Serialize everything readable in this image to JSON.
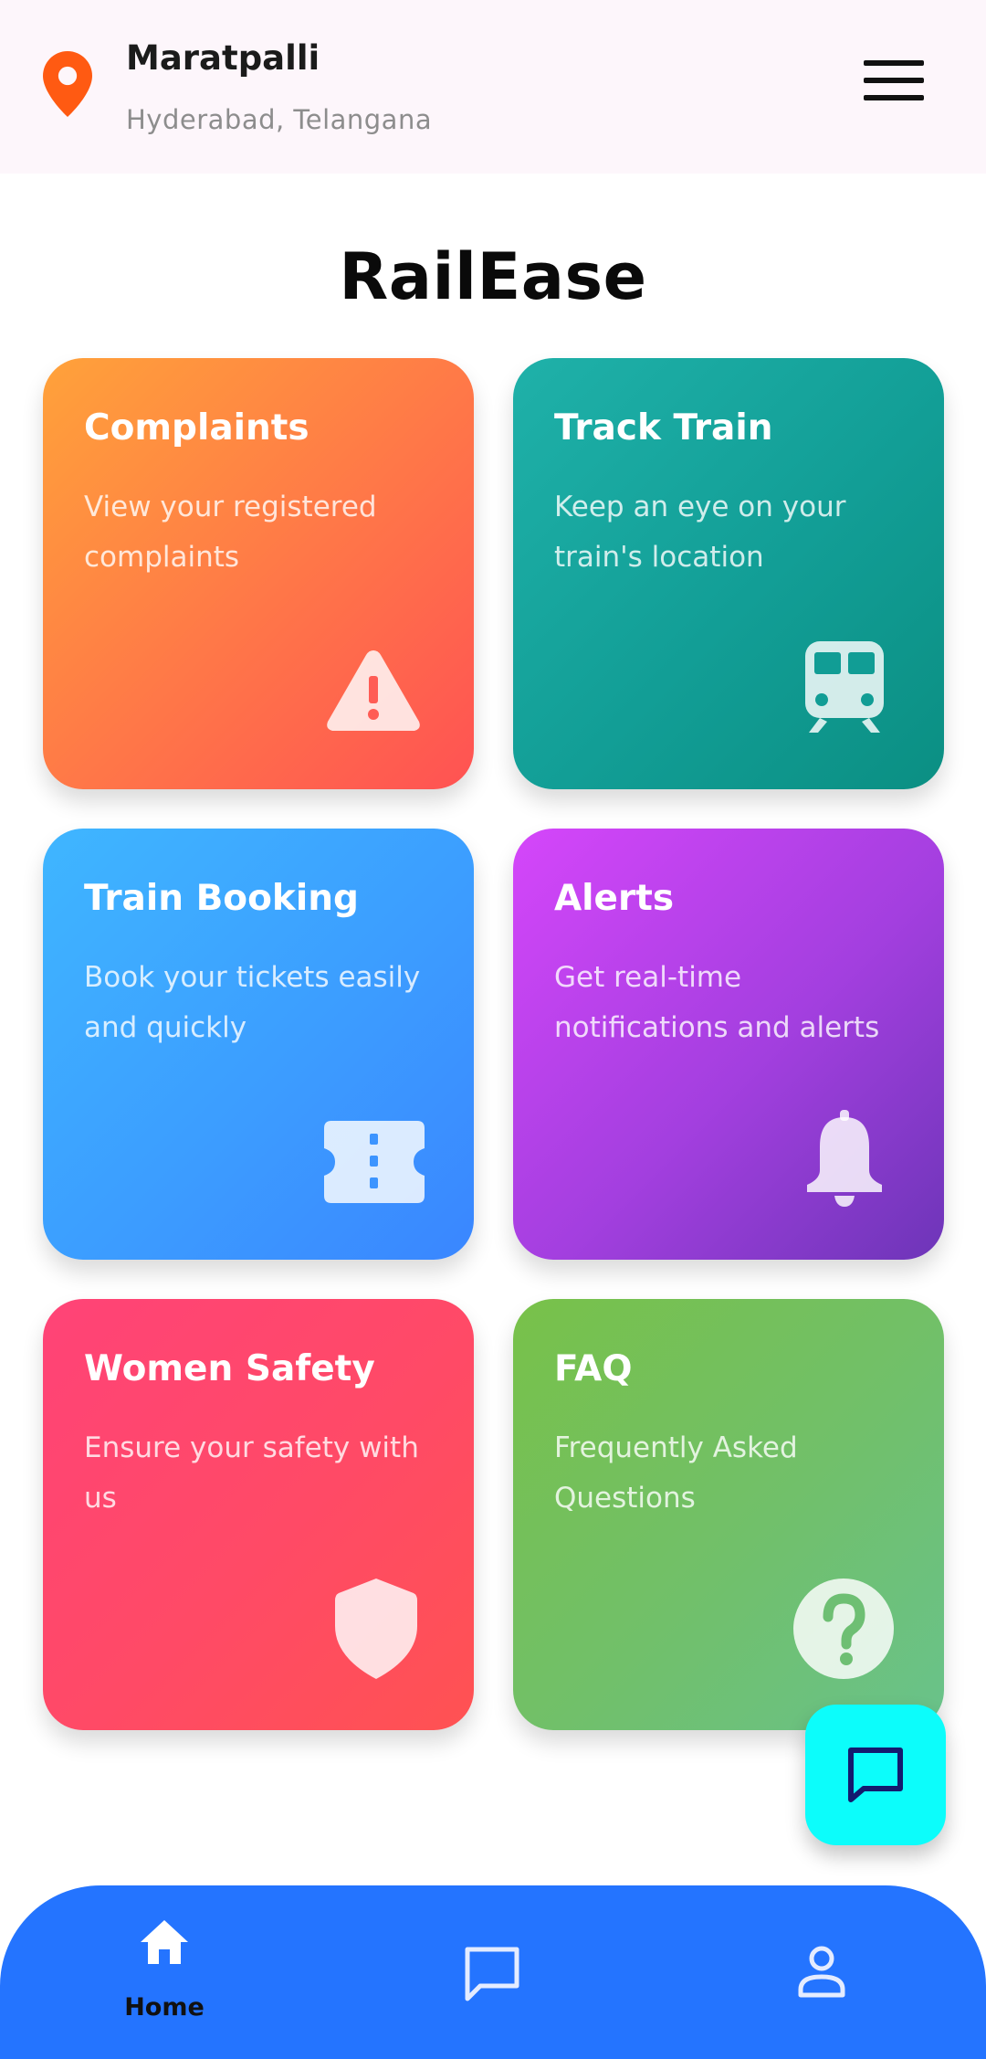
{
  "header": {
    "location_title": "Maratpalli",
    "location_subtitle": "Hyderabad, Telangana"
  },
  "app_title": "RailEase",
  "cards": [
    {
      "title": "Complaints",
      "desc": "View your registered complaints",
      "icon": "warning-triangle-icon"
    },
    {
      "title": "Track Train",
      "desc": "Keep an eye on your train's location",
      "icon": "train-icon"
    },
    {
      "title": "Train Booking",
      "desc": "Book your tickets easily and quickly",
      "icon": "ticket-icon"
    },
    {
      "title": "Alerts",
      "desc": "Get real-time notifications and alerts",
      "icon": "bell-icon"
    },
    {
      "title": "Women Safety",
      "desc": "Ensure your safety with us",
      "icon": "shield-icon"
    },
    {
      "title": "FAQ",
      "desc": "Frequently Asked Questions",
      "icon": "question-circle-icon"
    }
  ],
  "bottom_nav": {
    "home_label": "Home",
    "items": [
      "home-icon",
      "chat-icon",
      "profile-icon"
    ]
  },
  "colors": {
    "header_bg": "#fdf6fb",
    "location_pin": "#ff5a12",
    "nav_bg": "#2474ff",
    "chat_fab": "#0cfdfb",
    "complaints": [
      "#ffa23a",
      "#ff5253"
    ],
    "track_train": [
      "#1fb1a9",
      "#0b8f83"
    ],
    "train_booking": [
      "#3fb6ff",
      "#3a86ff"
    ],
    "alerts": [
      "#d546fa",
      "#6d35b8"
    ],
    "women_safety": [
      "#ff4377",
      "#ff5252"
    ],
    "faq": [
      "#78c149",
      "#69c28b"
    ]
  }
}
